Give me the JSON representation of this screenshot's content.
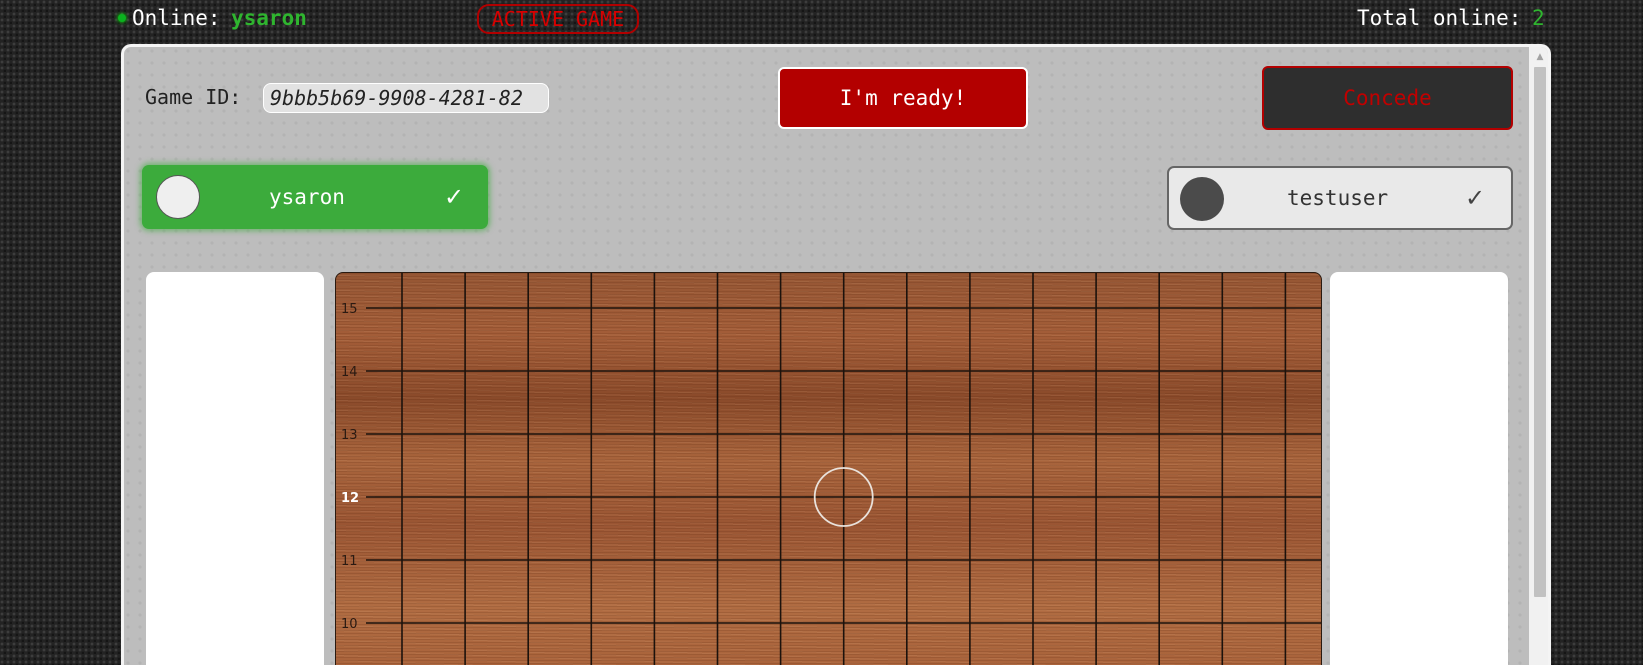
{
  "topbar": {
    "online_label": "Online:",
    "online_user": "ysaron",
    "status_badge": "ACTIVE GAME",
    "total_label": "Total online:",
    "total_count": "2"
  },
  "game": {
    "id_label": "Game ID:",
    "id_value": "9bbb5b69-9908-4281-82",
    "ready_label": "I'm ready!",
    "concede_label": "Concede"
  },
  "players": {
    "me": {
      "name": "ysaron",
      "stone": "white",
      "ready_mark": "✓"
    },
    "opponent": {
      "name": "testuser",
      "stone": "black",
      "ready_mark": "✓"
    }
  },
  "board": {
    "visible_rows": [
      "15",
      "14",
      "13",
      "12",
      "11",
      "10"
    ],
    "highlighted_row": "12",
    "hover_marker": "circle"
  },
  "scrollbar": {
    "up_arrow": "▲"
  },
  "colors": {
    "accent_green": "#2fb52f",
    "danger_red": "#b30000",
    "panel_bg": "#bdbdbd"
  }
}
